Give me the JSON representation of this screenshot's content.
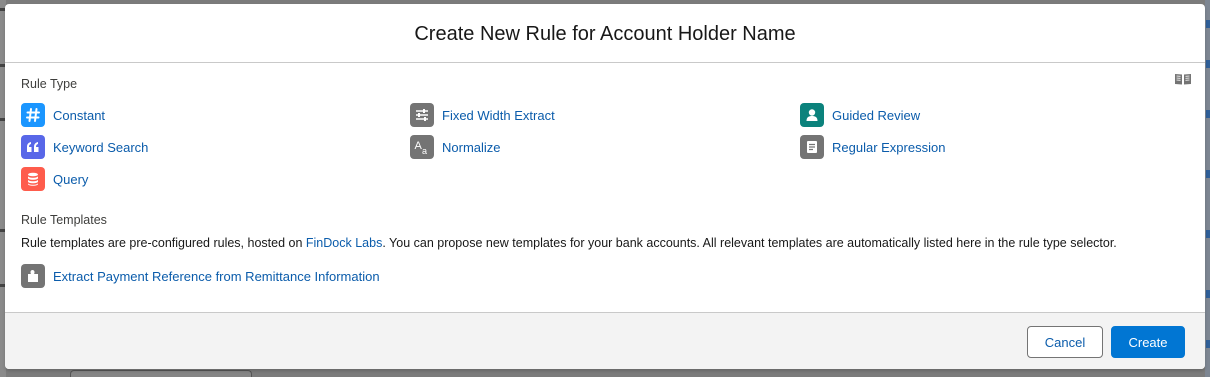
{
  "modal": {
    "title": "Create New Rule for Account Holder Name"
  },
  "rule_type": {
    "label": "Rule Type",
    "items": [
      {
        "label": "Constant",
        "icon": "hash-icon",
        "color": "#1b96ff"
      },
      {
        "label": "Fixed Width Extract",
        "icon": "sliders-icon",
        "color": "#747474"
      },
      {
        "label": "Guided Review",
        "icon": "user-icon",
        "color": "#0b827c"
      },
      {
        "label": "Keyword Search",
        "icon": "quote-icon",
        "color": "#5867e8"
      },
      {
        "label": "Normalize",
        "icon": "text-case-icon",
        "color": "#747474"
      },
      {
        "label": "Regular Expression",
        "icon": "document-lines-icon",
        "color": "#747474"
      },
      {
        "label": "Query",
        "icon": "database-icon",
        "color": "#fe5c4c"
      }
    ]
  },
  "rule_templates": {
    "label": "Rule Templates",
    "description_before": "Rule templates are pre-configured rules, hosted on ",
    "link_text": "FinDock Labs",
    "description_after": ". You can propose new templates for your bank accounts. All relevant templates are automatically listed here in the rule type selector.",
    "items": [
      {
        "label": "Extract Payment Reference from Remittance Information",
        "icon": "puzzle-icon",
        "color": "#747474"
      }
    ]
  },
  "footer": {
    "cancel_label": "Cancel",
    "create_label": "Create"
  },
  "colors": {
    "link": "#0b5cab",
    "brand_button": "#0176d3"
  }
}
